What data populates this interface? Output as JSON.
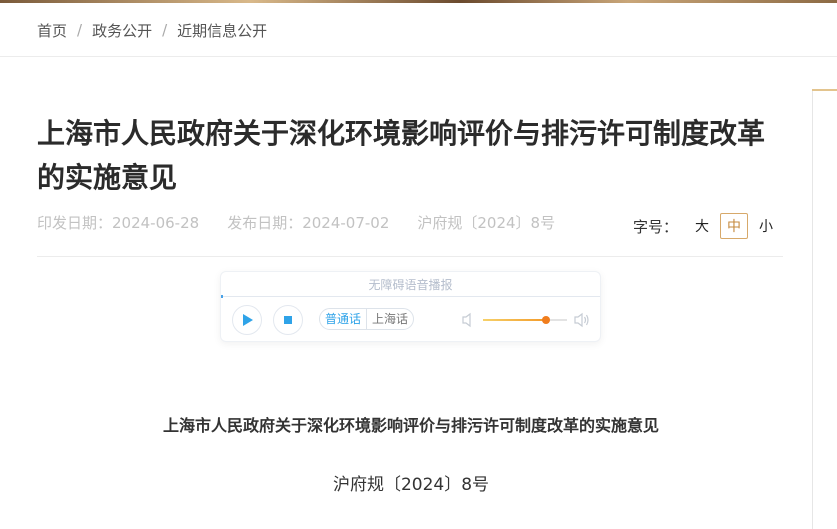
{
  "breadcrumb": {
    "items": [
      "首页",
      "政务公开",
      "近期信息公开"
    ],
    "separator": "/"
  },
  "article": {
    "title": "上海市人民政府关于深化环境影响评价与排污许可制度改革的实施意见",
    "meta": {
      "issue_date": "印发日期：2024-06-28",
      "publish_date": "发布日期：2024-07-02",
      "doc_number": "沪府规〔2024〕8号"
    }
  },
  "font_size": {
    "label": "字号：",
    "options": [
      "大",
      "中",
      "小"
    ],
    "selected": "中"
  },
  "player": {
    "title": "无障碍语音播报",
    "languages": [
      "普通话",
      "上海话"
    ],
    "selected_language": "普通话",
    "volume_level": 0.75,
    "icons": [
      "play-icon",
      "stop-icon",
      "volume-low-icon",
      "volume-high-icon"
    ]
  },
  "body": {
    "heading": "上海市人民政府关于深化环境影响评价与排污许可制度改革的实施意见",
    "doc_number": "沪府规〔2024〕8号"
  },
  "colors": {
    "accent": "#d7a96a",
    "player_blue": "#2fa3e8",
    "volume_orange": "#f07d1e"
  }
}
